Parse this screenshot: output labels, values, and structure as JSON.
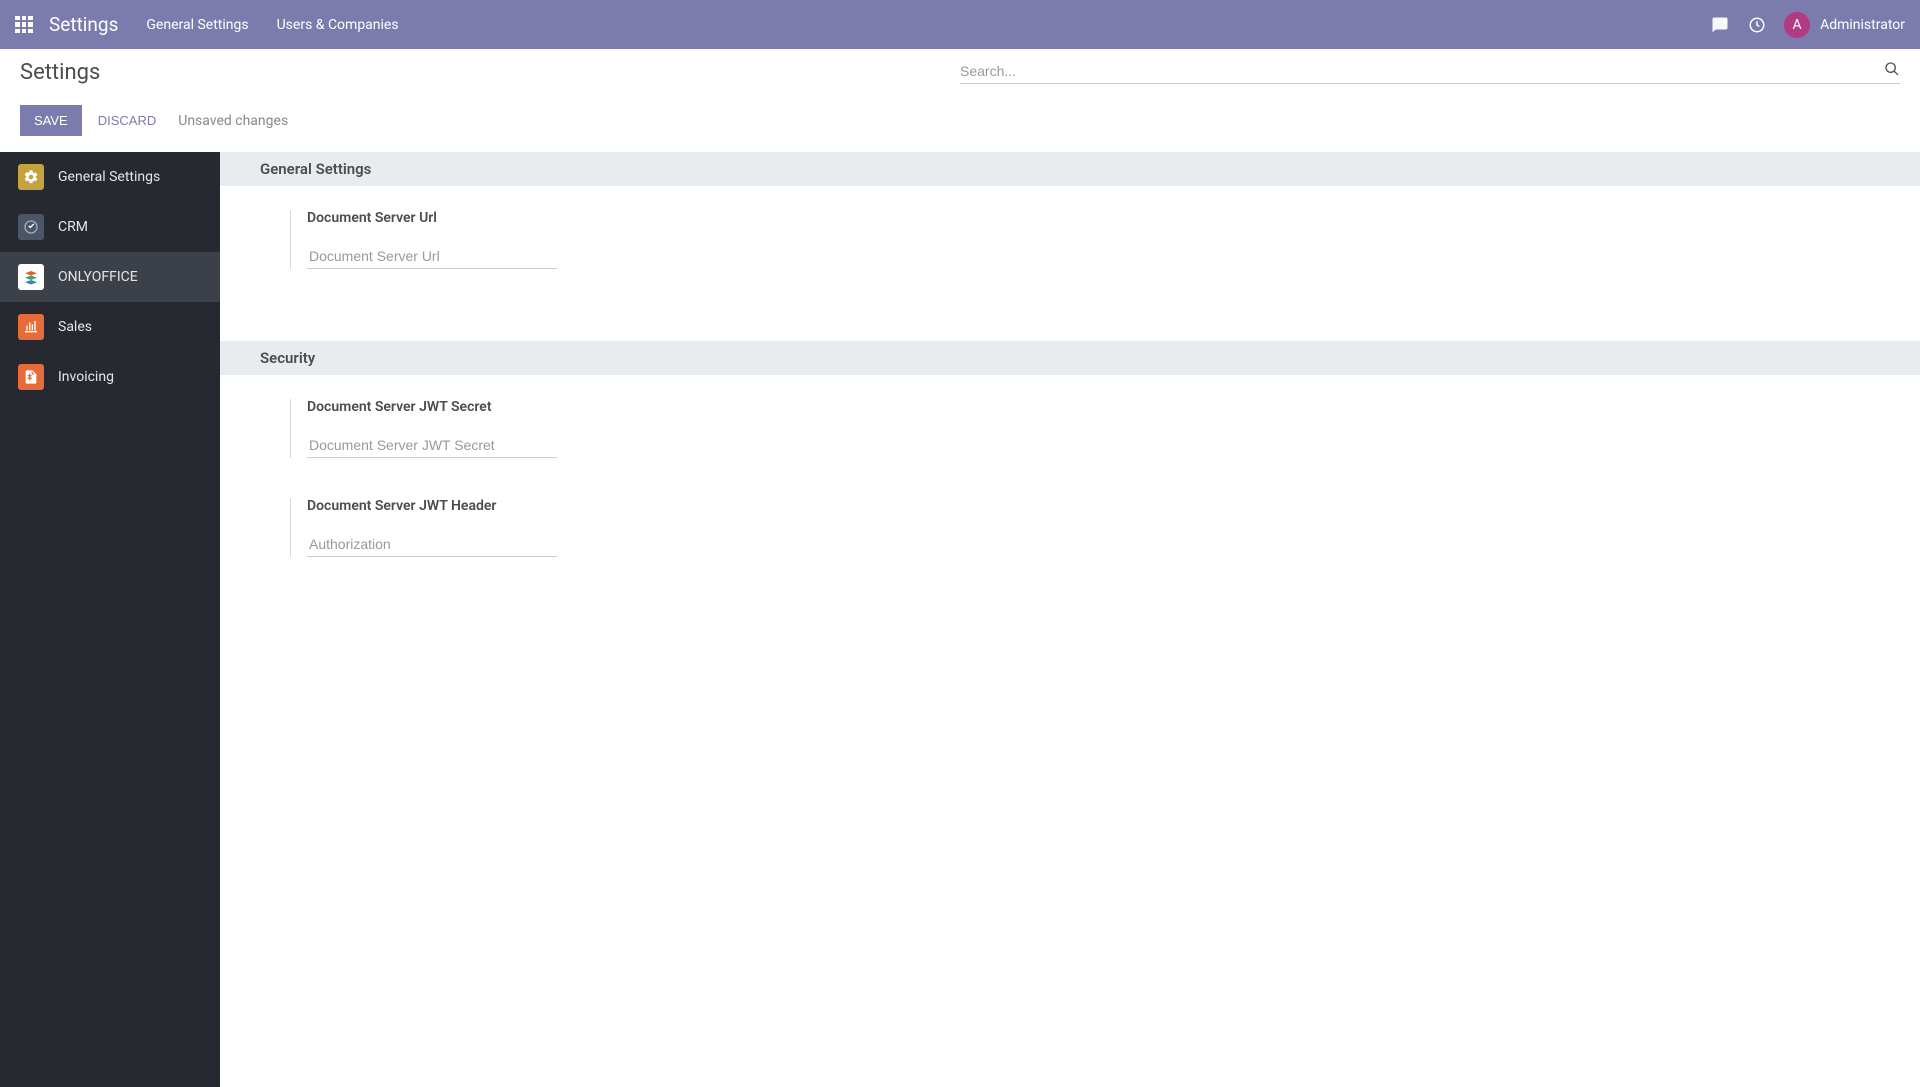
{
  "navbar": {
    "title": "Settings",
    "menu": [
      "General Settings",
      "Users & Companies"
    ],
    "user": {
      "initial": "A",
      "name": "Administrator"
    }
  },
  "page": {
    "title": "Settings",
    "search_placeholder": "Search..."
  },
  "buttons": {
    "save": "SAVE",
    "discard": "DISCARD",
    "status": "Unsaved changes"
  },
  "sidebar": {
    "items": [
      {
        "label": "General Settings",
        "icon_bg": "#c5a23e"
      },
      {
        "label": "CRM",
        "icon_bg": "#4a5568"
      },
      {
        "label": "ONLYOFFICE",
        "icon_bg": "#ffffff"
      },
      {
        "label": "Sales",
        "icon_bg": "#e86c3a"
      },
      {
        "label": "Invoicing",
        "icon_bg": "#e86c3a"
      }
    ]
  },
  "sections": {
    "general": {
      "title": "General Settings",
      "fields": {
        "doc_url": {
          "label": "Document Server Url",
          "placeholder": "Document Server Url",
          "value": ""
        }
      }
    },
    "security": {
      "title": "Security",
      "fields": {
        "jwt_secret": {
          "label": "Document Server JWT Secret",
          "placeholder": "Document Server JWT Secret",
          "value": ""
        },
        "jwt_header": {
          "label": "Document Server JWT Header",
          "placeholder": "Authorization",
          "value": ""
        }
      }
    }
  }
}
